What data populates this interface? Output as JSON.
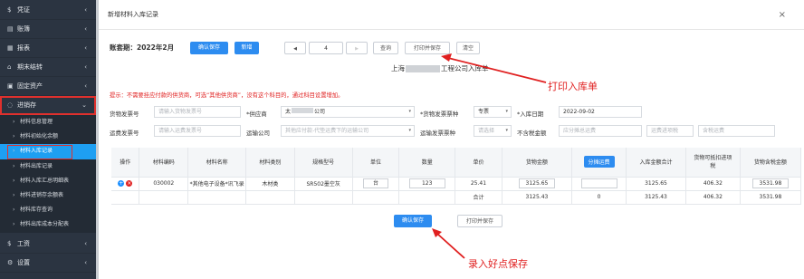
{
  "sidebar": {
    "items": [
      {
        "icon": "$",
        "label": "凭证",
        "chevron": "‹"
      },
      {
        "icon": "▤",
        "label": "账簿",
        "chevron": "‹"
      },
      {
        "icon": "▦",
        "label": "报表",
        "chevron": "‹"
      },
      {
        "icon": "⌂",
        "label": "期末结转",
        "chevron": "‹"
      },
      {
        "icon": "▣",
        "label": "固定资产",
        "chevron": "‹"
      },
      {
        "icon": "◌",
        "label": "进销存",
        "chevron": "⌄"
      }
    ],
    "sub_items": [
      {
        "label": "材料信息管理"
      },
      {
        "label": "材料初始化余额"
      },
      {
        "label": "材料入库记录"
      },
      {
        "label": "材料出库记录"
      },
      {
        "label": "材料入库汇总明细表"
      },
      {
        "label": "材料进销存余额表"
      },
      {
        "label": "材料库存查询"
      },
      {
        "label": "材料出库成本分配表"
      }
    ],
    "bottom_items": [
      {
        "icon": "$",
        "label": "工资",
        "chevron": "‹"
      },
      {
        "icon": "⚙",
        "label": "设置",
        "chevron": "‹"
      }
    ]
  },
  "dialog": {
    "title": "新增材料入库记录",
    "close": "×"
  },
  "toolbar": {
    "period_label": "账套期：2022年2月",
    "confirm_save": "确认保存",
    "new": "新增",
    "prev": "◀",
    "page": "4",
    "next": "▶",
    "query": "查询",
    "print_save": "打印并保存",
    "clear": "清空"
  },
  "doc_title_left": "上海",
  "doc_title_right": "工程公司入库单",
  "hint": "提示：不需要挂应付款的供货商，可选“其他供货商”，没有这个科目的，通过科目设置增加。",
  "form": {
    "row1": {
      "invoice_no_label": "货物发票号",
      "invoice_no_placeholder": "请输入货物发票号",
      "supplier_label": "*供应商",
      "supplier_value": "太",
      "supplier_value_end": "公司",
      "invoice_type_label": "*货物发票票种",
      "invoice_type_value": "专票",
      "in_date_label": "*入库日期",
      "in_date_value": "2022-09-02"
    },
    "row2": {
      "freight_no_label": "运费发票号",
      "freight_no_placeholder": "请输入运费发票号",
      "carrier_label": "运输公司",
      "carrier_value": "其他应付款-代垫运费下的运输公司",
      "freight_type_label": "运输发票票种",
      "freight_type_value": "请选择",
      "tax_excl_label": "不含税金额",
      "tax_excl_placeholder": "应分摊总运费",
      "freight_tax_placeholder": "运费进项税",
      "tax_incl_placeholder": "含税运费"
    }
  },
  "table": {
    "headers": [
      "操作",
      "材料编码",
      "材料名称",
      "材料类别",
      "规格型号",
      "单位",
      "数量",
      "单价",
      "货物金额",
      "分摊运费",
      "入库金额合计",
      "货物可抵扣进项税",
      "货物含税金额"
    ],
    "row": {
      "op_add": "+",
      "op_del": "×",
      "code": "030002",
      "name": "*其他电子设备*讯飞录",
      "category": "木材类",
      "spec": "SR502墨空灰",
      "unit": "台",
      "qty": "123",
      "price": "25.41",
      "amount": "3125.65",
      "freight": "",
      "total": "3125.65",
      "tax": "406.32",
      "tax_incl": "3531.98"
    },
    "sum_row": {
      "label": "合计",
      "amount": "3125.43",
      "freight": "0",
      "total": "3125.43",
      "tax": "406.32",
      "tax_incl": "3531.98"
    }
  },
  "bottom_buttons": {
    "confirm_save": "确认保存",
    "print_save": "打印并保存"
  },
  "annotations": {
    "print": "打印入库单",
    "save": "录入好点保存"
  }
}
